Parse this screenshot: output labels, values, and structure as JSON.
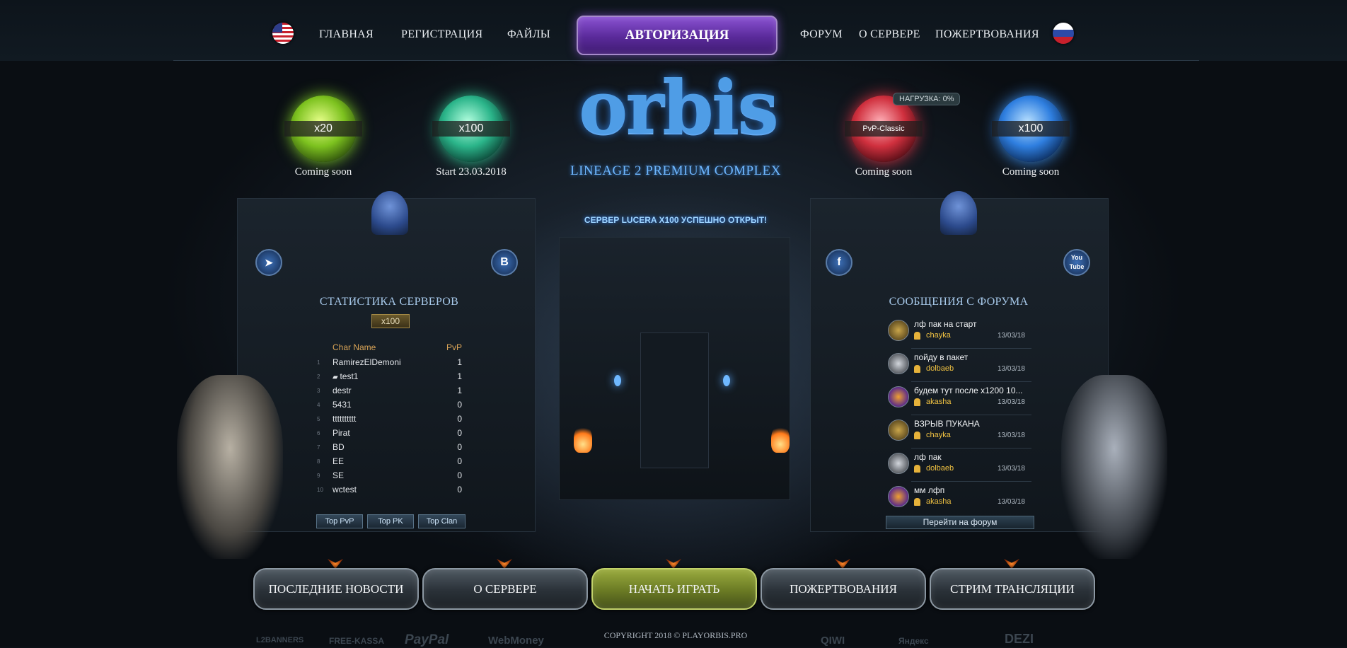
{
  "nav": {
    "home": "ГЛАВНАЯ",
    "register": "РЕГИСТРАЦИЯ",
    "files": "ФАЙЛЫ",
    "auth": "АВТОРИЗАЦИЯ",
    "forum": "ФОРУМ",
    "about": "О СЕРВЕРЕ",
    "donate": "ПОЖЕРТВОВАНИЯ",
    "flag_left": "us-flag-icon",
    "flag_right": "ru-flag-icon"
  },
  "servers": [
    {
      "label": "x20",
      "caption": "Coming soon",
      "color": "#7ecb26"
    },
    {
      "label": "x100",
      "caption": "Start 23.03.2018",
      "color": "#2fc18f"
    },
    {
      "label": "PvP-Classic",
      "caption": "Coming soon",
      "color": "#d53040"
    },
    {
      "label": "x100",
      "caption": "Coming soon",
      "color": "#3a8ff0"
    }
  ],
  "load_badge": "НАГРУЗКА: 0%",
  "logo": {
    "title": "orbis",
    "subtitle": "LINEAGE 2 PREMIUM COMPLEX"
  },
  "announcement": "СЕРВЕР LUCERA X100 УСПЕШНО ОТКРЫТ!",
  "social": {
    "telegram": "telegram-icon",
    "vk": "B",
    "facebook": "f",
    "youtube": "You Tube"
  },
  "stats": {
    "title": "СТАТИСТИКА СЕРВЕРОВ",
    "server_tab": "x100",
    "col_name": "Char Name",
    "col_pvp": "PvP",
    "rows": [
      {
        "n": "1",
        "name": "RamirezElDemoni",
        "pvp": "1"
      },
      {
        "n": "2",
        "name": "test1",
        "pvp": "1"
      },
      {
        "n": "3",
        "name": "destr",
        "pvp": "1"
      },
      {
        "n": "4",
        "name": "5431",
        "pvp": "0"
      },
      {
        "n": "5",
        "name": "tttttttttt",
        "pvp": "0"
      },
      {
        "n": "6",
        "name": "Pirat",
        "pvp": "0"
      },
      {
        "n": "7",
        "name": "BD",
        "pvp": "0"
      },
      {
        "n": "8",
        "name": "EE",
        "pvp": "0"
      },
      {
        "n": "9",
        "name": "SE",
        "pvp": "0"
      },
      {
        "n": "10",
        "name": "wctest",
        "pvp": "0"
      }
    ],
    "tabs": [
      "Top PvP",
      "Top PK",
      "Top Clan"
    ]
  },
  "forum": {
    "title": "СООБЩЕНИЯ С ФОРУМА",
    "posts": [
      {
        "title": "лф пак на старт",
        "user": "chayka",
        "date": "13/03/18"
      },
      {
        "title": "пойду в пакет",
        "user": "dolbaeb",
        "date": "13/03/18"
      },
      {
        "title": "будем тут после х1200 10...",
        "user": "akasha",
        "date": "13/03/18"
      },
      {
        "title": "ВЗРЫВ ПУКАНА",
        "user": "chayka",
        "date": "13/03/18"
      },
      {
        "title": "лф пак",
        "user": "dolbaeb",
        "date": "13/03/18"
      },
      {
        "title": "мм лфп",
        "user": "akasha",
        "date": "13/03/18"
      }
    ],
    "button": "Перейти на форум"
  },
  "bottom_buttons": [
    "ПОСЛЕДНИЕ НОВОСТИ",
    "О СЕРВЕРЕ",
    "НАЧАТЬ ИГРАТЬ",
    "ПОЖЕРТВОВАНИЯ",
    "СТРИМ ТРАНСЛЯЦИИ"
  ],
  "footer": {
    "copyright": "COPYRIGHT 2018 © PLAYORBIS.PRO",
    "logos": [
      "L2BANNERS",
      "FREE-KASSA",
      "PayPal",
      "WebMoney",
      "QIWI",
      "Яндекс",
      "DEZI"
    ]
  }
}
